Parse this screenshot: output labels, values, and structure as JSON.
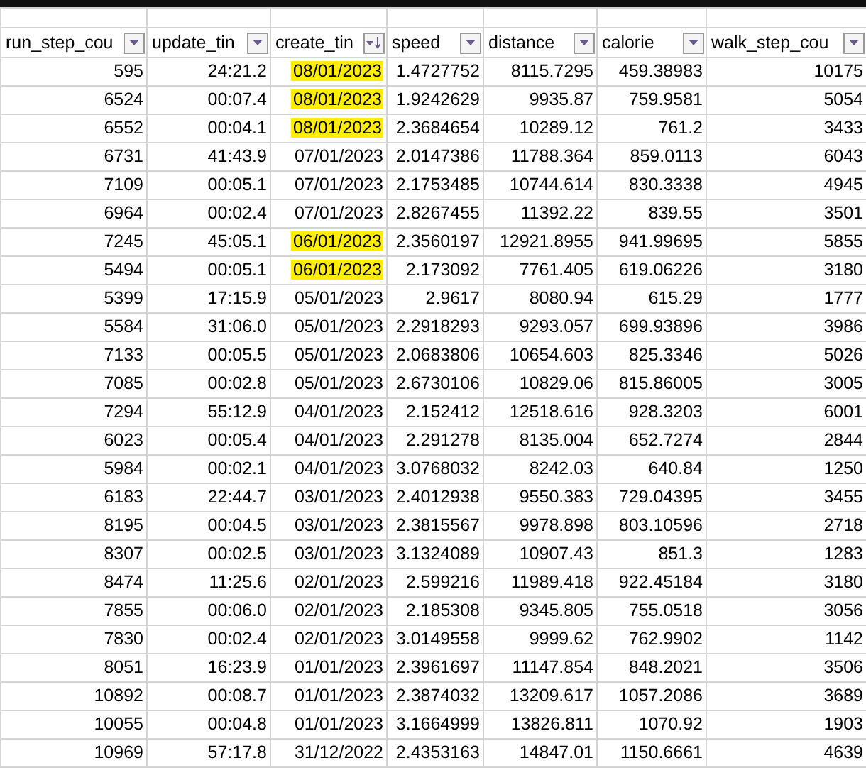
{
  "columns": [
    {
      "label": "run_step_cou",
      "kind": "number",
      "sorted": false
    },
    {
      "label": "update_tin",
      "kind": "time",
      "sorted": false
    },
    {
      "label": "create_tin",
      "kind": "date",
      "sorted": true
    },
    {
      "label": "speed",
      "kind": "number",
      "sorted": false
    },
    {
      "label": "distance",
      "kind": "number",
      "sorted": false
    },
    {
      "label": "calorie",
      "kind": "number",
      "sorted": false
    },
    {
      "label": "walk_step_cou",
      "kind": "number",
      "sorted": false
    }
  ],
  "rows": [
    {
      "cells": [
        "595",
        "24:21.2",
        "08/01/2023",
        "1.4727752",
        "8115.7295",
        "459.38983",
        "10175"
      ],
      "highlighted": true
    },
    {
      "cells": [
        "6524",
        "00:07.4",
        "08/01/2023",
        "1.9242629",
        "9935.87",
        "759.9581",
        "5054"
      ],
      "highlighted": true
    },
    {
      "cells": [
        "6552",
        "00:04.1",
        "08/01/2023",
        "2.3684654",
        "10289.12",
        "761.2",
        "3433"
      ],
      "highlighted": true
    },
    {
      "cells": [
        "6731",
        "41:43.9",
        "07/01/2023",
        "2.0147386",
        "11788.364",
        "859.0113",
        "6043"
      ],
      "highlighted": false
    },
    {
      "cells": [
        "7109",
        "00:05.1",
        "07/01/2023",
        "2.1753485",
        "10744.614",
        "830.3338",
        "4945"
      ],
      "highlighted": false
    },
    {
      "cells": [
        "6964",
        "00:02.4",
        "07/01/2023",
        "2.8267455",
        "11392.22",
        "839.55",
        "3501"
      ],
      "highlighted": false
    },
    {
      "cells": [
        "7245",
        "45:05.1",
        "06/01/2023",
        "2.3560197",
        "12921.8955",
        "941.99695",
        "5855"
      ],
      "highlighted": true
    },
    {
      "cells": [
        "5494",
        "00:05.1",
        "06/01/2023",
        "2.173092",
        "7761.405",
        "619.06226",
        "3180"
      ],
      "highlighted": true
    },
    {
      "cells": [
        "5399",
        "17:15.9",
        "05/01/2023",
        "2.9617",
        "8080.94",
        "615.29",
        "1777"
      ],
      "highlighted": false
    },
    {
      "cells": [
        "5584",
        "31:06.0",
        "05/01/2023",
        "2.2918293",
        "9293.057",
        "699.93896",
        "3986"
      ],
      "highlighted": false
    },
    {
      "cells": [
        "7133",
        "00:05.5",
        "05/01/2023",
        "2.0683806",
        "10654.603",
        "825.3346",
        "5026"
      ],
      "highlighted": false
    },
    {
      "cells": [
        "7085",
        "00:02.8",
        "05/01/2023",
        "2.6730106",
        "10829.06",
        "815.86005",
        "3005"
      ],
      "highlighted": false
    },
    {
      "cells": [
        "7294",
        "55:12.9",
        "04/01/2023",
        "2.152412",
        "12518.616",
        "928.3203",
        "6001"
      ],
      "highlighted": false
    },
    {
      "cells": [
        "6023",
        "00:05.4",
        "04/01/2023",
        "2.291278",
        "8135.004",
        "652.7274",
        "2844"
      ],
      "highlighted": false
    },
    {
      "cells": [
        "5984",
        "00:02.1",
        "04/01/2023",
        "3.0768032",
        "8242.03",
        "640.84",
        "1250"
      ],
      "highlighted": false
    },
    {
      "cells": [
        "6183",
        "22:44.7",
        "03/01/2023",
        "2.4012938",
        "9550.383",
        "729.04395",
        "3455"
      ],
      "highlighted": false
    },
    {
      "cells": [
        "8195",
        "00:04.5",
        "03/01/2023",
        "2.3815567",
        "9978.898",
        "803.10596",
        "2718"
      ],
      "highlighted": false
    },
    {
      "cells": [
        "8307",
        "00:02.5",
        "03/01/2023",
        "3.1324089",
        "10907.43",
        "851.3",
        "1283"
      ],
      "highlighted": false
    },
    {
      "cells": [
        "8474",
        "11:25.6",
        "02/01/2023",
        "2.599216",
        "11989.418",
        "922.45184",
        "3180"
      ],
      "highlighted": false
    },
    {
      "cells": [
        "7855",
        "00:06.0",
        "02/01/2023",
        "2.185308",
        "9345.805",
        "755.0518",
        "3056"
      ],
      "highlighted": false
    },
    {
      "cells": [
        "7830",
        "00:02.4",
        "02/01/2023",
        "3.0149558",
        "9999.62",
        "762.9902",
        "1142"
      ],
      "highlighted": false
    },
    {
      "cells": [
        "8051",
        "16:23.9",
        "01/01/2023",
        "2.3961697",
        "11147.854",
        "848.2021",
        "3506"
      ],
      "highlighted": false
    },
    {
      "cells": [
        "10892",
        "00:08.7",
        "01/01/2023",
        "2.3874032",
        "13209.617",
        "1057.2086",
        "3689"
      ],
      "highlighted": false
    },
    {
      "cells": [
        "10055",
        "00:04.8",
        "01/01/2023",
        "3.1664999",
        "13826.811",
        "1070.92",
        "1903"
      ],
      "highlighted": false
    },
    {
      "cells": [
        "10969",
        "57:17.8",
        "31/12/2022",
        "2.4353163",
        "14847.01",
        "1150.6661",
        "4639"
      ],
      "highlighted": false
    }
  ]
}
